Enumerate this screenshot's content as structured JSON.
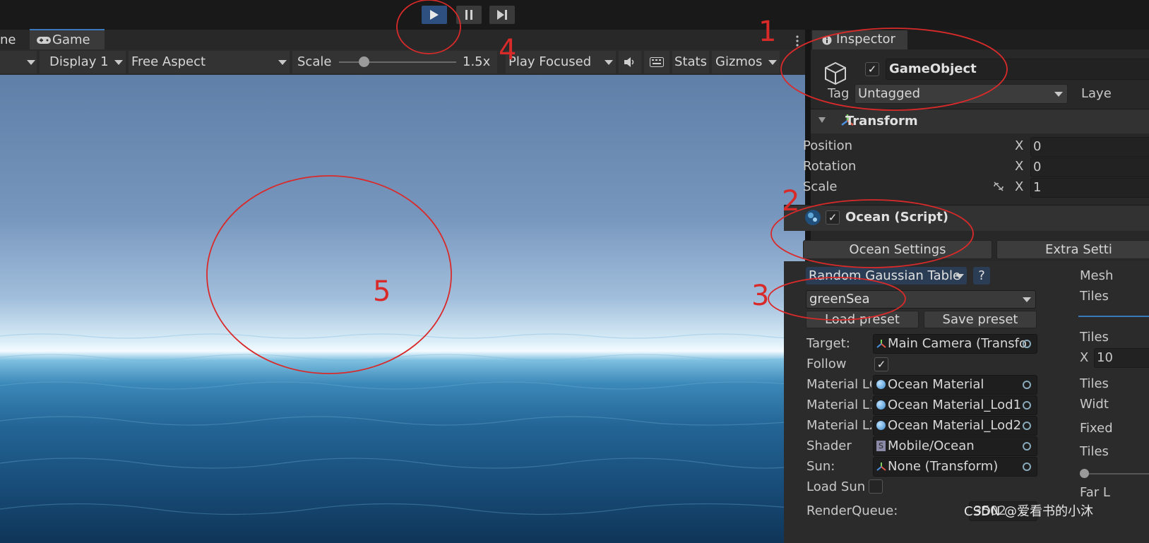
{
  "tabs": {
    "scene_partial": "ne",
    "game": "Game",
    "inspector": "Inspector"
  },
  "game_toolbar": {
    "display": "Display 1",
    "aspect": "Free Aspect",
    "scale_label": "Scale",
    "scale_value": "1.5x",
    "play_mode": "Play Focused",
    "stats": "Stats",
    "gizmos": "Gizmos"
  },
  "inspector": {
    "object_name": "GameObject",
    "tag_label": "Tag",
    "tag_value": "Untagged",
    "layer_partial": "Laye",
    "transform": {
      "title": "Transform",
      "rows": [
        {
          "label": "Position",
          "axis": "X",
          "value": "0"
        },
        {
          "label": "Rotation",
          "axis": "X",
          "value": "0"
        },
        {
          "label": "Scale",
          "axis": "X",
          "value": "1"
        }
      ]
    },
    "ocean": {
      "title": "Ocean (Script)",
      "tab_settings": "Ocean Settings",
      "tab_extra": "Extra Setti",
      "gaussian": "Random Gaussian Table",
      "help": "?",
      "preset": "greenSea",
      "load_preset": "Load preset",
      "save_preset": "Save preset",
      "fields": [
        {
          "label": "Target:",
          "value": "Main Camera (Transfo"
        },
        {
          "label": "Follow",
          "value": ""
        },
        {
          "label": "Material LC",
          "value": "Ocean Material"
        },
        {
          "label": "Material L1",
          "value": "Ocean Material_Lod1"
        },
        {
          "label": "Material L2",
          "value": "Ocean Material_Lod2"
        },
        {
          "label": "Shader",
          "value": "Mobile/Ocean"
        },
        {
          "label": "Sun:",
          "value": "None (Transform)"
        },
        {
          "label": "Load Sun",
          "value": ""
        },
        {
          "label": "RenderQueue:",
          "value": "3502"
        }
      ],
      "right_column": [
        "Mesh",
        "Tiles",
        "Tiles",
        "X",
        "10",
        "Tiles",
        "Widt",
        "Fixed",
        "Tiles",
        "Far L"
      ]
    }
  },
  "annotations": [
    "1",
    "2",
    "3",
    "4",
    "5"
  ],
  "watermark": "CSDN @爱看书的小沐",
  "colors": {
    "annotation": "#d92a2a",
    "play_active": "#2e5080"
  }
}
